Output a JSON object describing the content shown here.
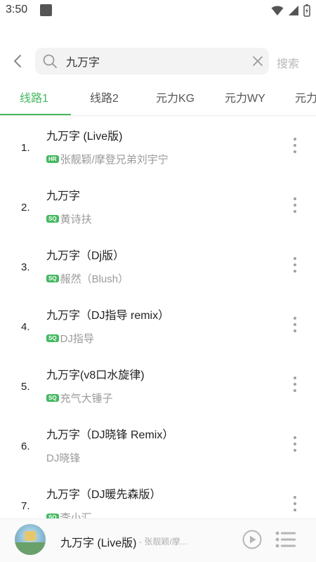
{
  "status": {
    "time": "3:50"
  },
  "search": {
    "query": "九万字",
    "submit_label": "搜索"
  },
  "tabs": [
    {
      "label": "线路1",
      "active": true
    },
    {
      "label": "线路2"
    },
    {
      "label": "元力KG"
    },
    {
      "label": "元力WY"
    },
    {
      "label": "元力"
    }
  ],
  "songs": [
    {
      "index": "1.",
      "title": "九万字 (Live版)",
      "badge": "HR",
      "artist": "张靓颖/摩登兄弟刘宇宁"
    },
    {
      "index": "2.",
      "title": "九万字",
      "badge": "SQ",
      "artist": "黄诗扶"
    },
    {
      "index": "3.",
      "title": "九万字（Dj版）",
      "badge": "SQ",
      "artist": "赧然（Blush）"
    },
    {
      "index": "4.",
      "title": "九万字（DJ指导 remix）",
      "badge": "SQ",
      "artist": "DJ指导"
    },
    {
      "index": "5.",
      "title": "九万字(v8口水旋律)",
      "badge": "SQ",
      "artist": "充气大锤子"
    },
    {
      "index": "6.",
      "title": "九万字（DJ晓锋 Remix）",
      "badge": "",
      "artist": "DJ晓锋"
    },
    {
      "index": "7.",
      "title": "九万字（DJ暖先森版）",
      "badge": "SQ",
      "artist": "李小汇"
    }
  ],
  "player": {
    "title": "九万字 (Live版)",
    "artist": "- 张靓颖/摩..."
  },
  "colors": {
    "accent": "#45b861",
    "muted": "#9a9a9a"
  }
}
